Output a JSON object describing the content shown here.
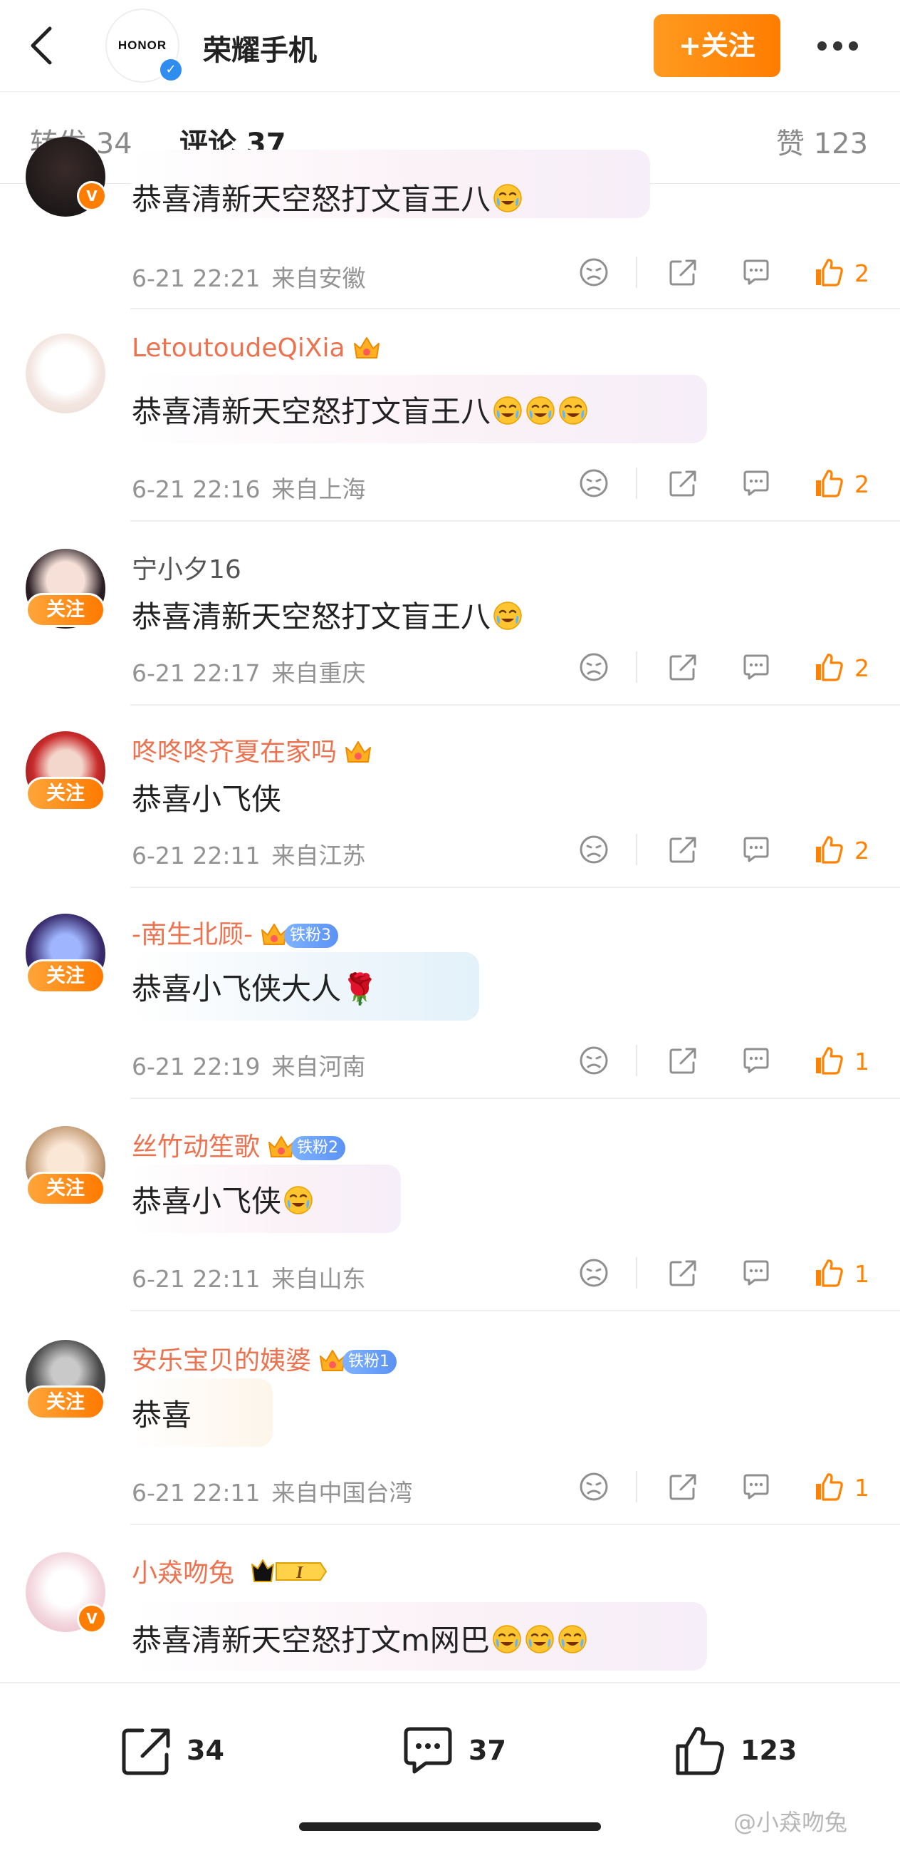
{
  "header": {
    "title": "荣耀手机",
    "brand_logo_text": "HONOR",
    "follow_label": "+关注"
  },
  "tabs": {
    "repost": "转发 34",
    "comments": "评论 37",
    "likes": "赞 123"
  },
  "comments": [
    {
      "name": "",
      "text": "恭喜清新天空怒打文盲王八",
      "date": "6-21 22:21",
      "location": "来自安徽",
      "likes": "2"
    },
    {
      "name": "LetoutoudeQiXia",
      "text": "恭喜清新天空怒打文盲王八",
      "date": "6-21 22:16",
      "location": "来自上海",
      "likes": "2"
    },
    {
      "name": "宁小夕16",
      "follow": "关注",
      "text": "恭喜清新天空怒打文盲王八",
      "date": "6-21 22:17",
      "location": "来自重庆",
      "likes": "2"
    },
    {
      "name": "咚咚咚齐夏在家吗",
      "follow": "关注",
      "text": "恭喜小飞侠",
      "date": "6-21 22:11",
      "location": "来自江苏",
      "likes": "2"
    },
    {
      "name": "-南生北顾-",
      "badge": "铁粉3",
      "follow": "关注",
      "text": "恭喜小飞侠大人",
      "date": "6-21 22:19",
      "location": "来自河南",
      "likes": "1"
    },
    {
      "name": "丝竹动笙歌",
      "badge": "铁粉2",
      "follow": "关注",
      "text": "恭喜小飞侠",
      "date": "6-21 22:11",
      "location": "来自山东",
      "likes": "1"
    },
    {
      "name": "安乐宝贝的姨婆",
      "badge": "铁粉1",
      "follow": "关注",
      "text": "恭喜",
      "date": "6-21 22:11",
      "location": "来自中国台湾",
      "likes": "1"
    },
    {
      "name": "小猋吻兔",
      "vip": "I",
      "text": "恭喜清新天空怒打文m网巴"
    }
  ],
  "bottom_bar": {
    "reposts": "34",
    "comments": "37",
    "likes": "123"
  },
  "watermark": "@小猋吻兔",
  "colors": {
    "accent": "#ff8200",
    "username": "#eb7350",
    "meta": "#939393",
    "fan_badge": "#5b92f5"
  },
  "icons": [
    "back-icon",
    "more-icon",
    "verified-icon",
    "dislike-icon",
    "share-icon",
    "comment-icon",
    "like-icon",
    "crown-icon"
  ]
}
